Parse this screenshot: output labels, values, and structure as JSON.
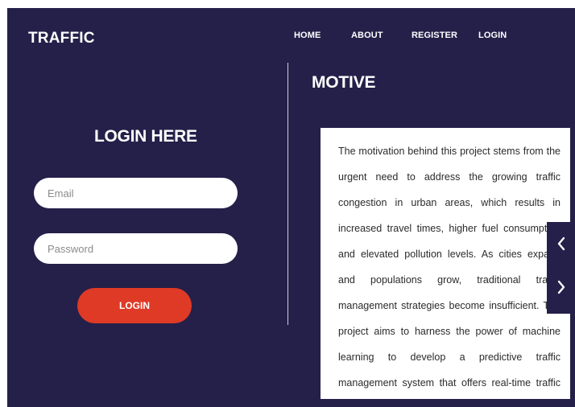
{
  "header": {
    "brand": "TRAFFIC",
    "nav": [
      {
        "label": "HOME"
      },
      {
        "label": "ABOUT"
      },
      {
        "label": "REGISTER"
      },
      {
        "label": "LOGIN"
      }
    ]
  },
  "login": {
    "heading": "LOGIN HERE",
    "email_placeholder": "Email",
    "email_value": "",
    "password_placeholder": "Password",
    "password_value": "",
    "button_label": "LOGIN"
  },
  "motive": {
    "title": "MOTIVE",
    "text": "The motivation behind this project stems from the urgent need to address the growing traffic congestion in urban areas, which results in increased travel times, higher fuel consumption and elevated pollution levels. As cities expand and populations grow, traditional traffic management strategies become insufficient. The project aims to harness the power of machine learning to develop a predictive traffic management system that offers real-time traffic conditions."
  },
  "carousel": {
    "prev_icon": "chevron-left-icon",
    "next_icon": "chevron-right-icon"
  },
  "colors": {
    "background": "#242049",
    "accent": "#de3a26",
    "card": "#ffffff",
    "text_light": "#ffffff"
  }
}
